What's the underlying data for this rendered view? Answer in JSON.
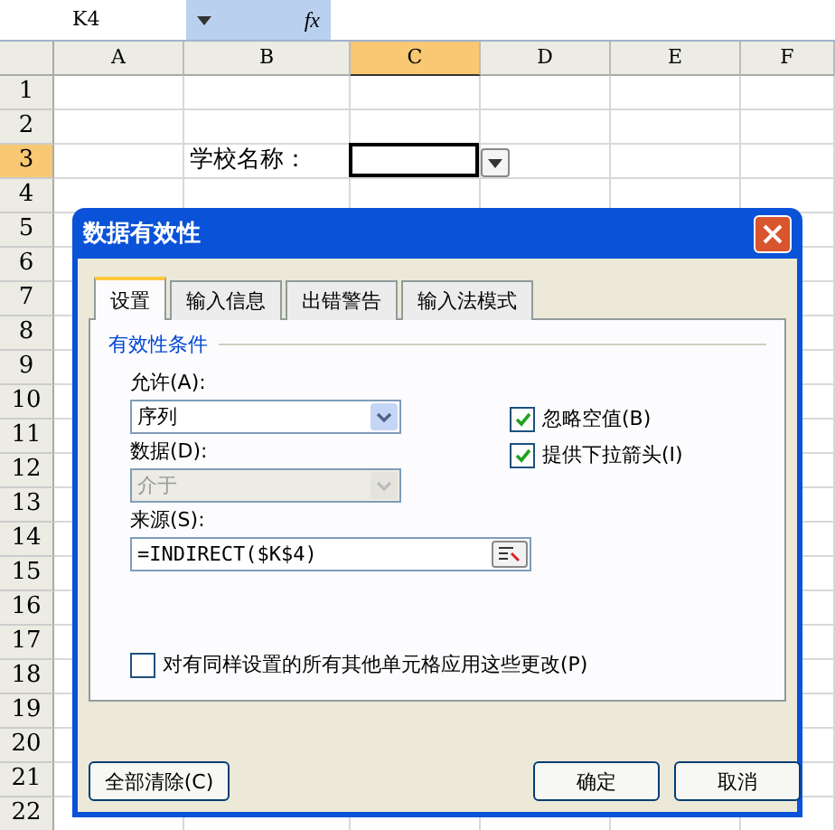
{
  "formula_bar": {
    "name_box": "K4",
    "function_label": "fx"
  },
  "columns": [
    {
      "label": "A",
      "selected": false
    },
    {
      "label": "B",
      "selected": false
    },
    {
      "label": "C",
      "selected": true
    },
    {
      "label": "D",
      "selected": false
    },
    {
      "label": "E",
      "selected": false
    },
    {
      "label": "F",
      "selected": false
    }
  ],
  "rows": [
    {
      "label": "1",
      "selected": false
    },
    {
      "label": "2",
      "selected": false
    },
    {
      "label": "3",
      "selected": true,
      "label_cell": "学校名称："
    },
    {
      "label": "4",
      "selected": false
    },
    {
      "label": "5",
      "selected": false
    },
    {
      "label": "6",
      "selected": false
    },
    {
      "label": "7",
      "selected": false
    },
    {
      "label": "8",
      "selected": false
    },
    {
      "label": "9",
      "selected": false
    },
    {
      "label": "10",
      "selected": false
    },
    {
      "label": "11",
      "selected": false
    },
    {
      "label": "12",
      "selected": false
    },
    {
      "label": "13",
      "selected": false
    },
    {
      "label": "14",
      "selected": false
    },
    {
      "label": "15",
      "selected": false
    },
    {
      "label": "16",
      "selected": false
    },
    {
      "label": "17",
      "selected": false
    },
    {
      "label": "18",
      "selected": false
    },
    {
      "label": "19",
      "selected": false
    },
    {
      "label": "20",
      "selected": false
    },
    {
      "label": "21",
      "selected": false
    },
    {
      "label": "22",
      "selected": false
    }
  ],
  "dialog": {
    "title": "数据有效性",
    "tabs": [
      {
        "label": "设置",
        "selected": true
      },
      {
        "label": "输入信息",
        "selected": false
      },
      {
        "label": "出错警告",
        "selected": false
      },
      {
        "label": "输入法模式",
        "selected": false
      }
    ],
    "group_title": "有效性条件",
    "allow": {
      "label": "允许(A):",
      "value": "序列",
      "disabled": false
    },
    "data": {
      "label": "数据(D):",
      "value": "介于",
      "disabled": true
    },
    "checkboxes": [
      {
        "label": "忽略空值(B)",
        "checked": true
      },
      {
        "label": "提供下拉箭头(I)",
        "checked": true
      }
    ],
    "source": {
      "label": "来源(S):",
      "value": "=INDIRECT($K$4)"
    },
    "apply_all": {
      "label": "对有同样设置的所有其他单元格应用这些更改(P)",
      "checked": false
    },
    "buttons": {
      "clear": "全部清除(C)",
      "ok": "确定",
      "cancel": "取消"
    }
  }
}
